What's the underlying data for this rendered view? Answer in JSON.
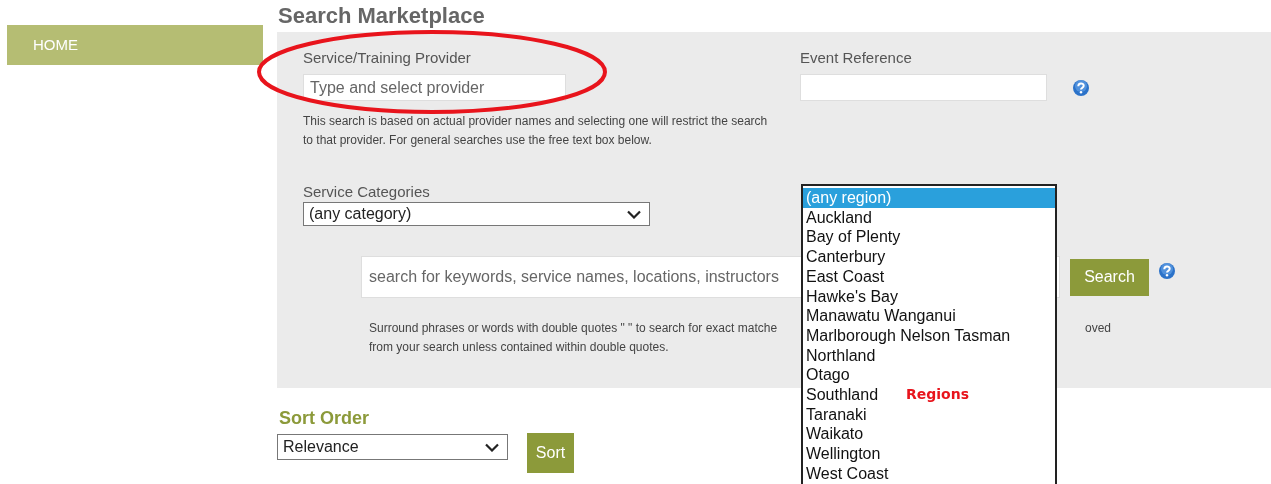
{
  "sidebar": {
    "items": [
      {
        "label": "HOME"
      }
    ]
  },
  "title": "Search Marketplace",
  "provider": {
    "label": "Service/Training Provider",
    "placeholder": "Type and select provider",
    "help": "This search is based on actual provider names and selecting one will restrict the search to that provider. For general searches use the free text box below."
  },
  "event_reference": {
    "label": "Event Reference"
  },
  "categories": {
    "label": "Service Categories",
    "value": "(any category)"
  },
  "keyword_search": {
    "placeholder": "search for keywords, service names, locations, instructors",
    "button": "Search"
  },
  "search_help": {
    "lines": [
      "Surround phrases or words with double quotes \" \" to search for exact matche",
      "from your search unless contained within double quotes."
    ],
    "right_fragment": "oved"
  },
  "sort": {
    "heading": "Sort Order",
    "value": "Relevance",
    "button": "Sort"
  },
  "region_list": {
    "items": [
      {
        "label": "(any region)",
        "selected": true
      },
      {
        "label": "Auckland",
        "selected": false
      },
      {
        "label": "Bay of Plenty",
        "selected": false
      },
      {
        "label": "Canterbury",
        "selected": false
      },
      {
        "label": "East Coast",
        "selected": false
      },
      {
        "label": "Hawke's Bay",
        "selected": false
      },
      {
        "label": "Manawatu Wanganui",
        "selected": false
      },
      {
        "label": "Marlborough Nelson Tasman",
        "selected": false
      },
      {
        "label": "Northland",
        "selected": false
      },
      {
        "label": "Otago",
        "selected": false
      },
      {
        "label": "Southland",
        "selected": false
      },
      {
        "label": "Taranaki",
        "selected": false
      },
      {
        "label": "Waikato",
        "selected": false
      },
      {
        "label": "Wellington",
        "selected": false
      },
      {
        "label": "West Coast",
        "selected": false
      }
    ]
  },
  "annotations": [
    {
      "kind": "ellipse"
    },
    {
      "kind": "text",
      "text": "Regions"
    }
  ]
}
